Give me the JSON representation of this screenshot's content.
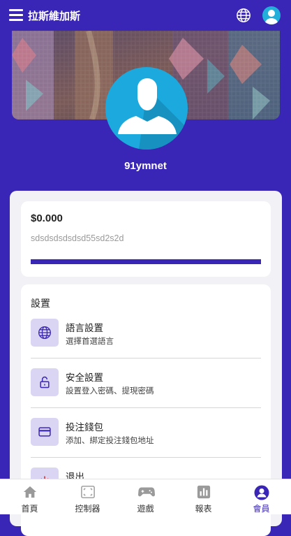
{
  "header": {
    "title": "拉斯維加斯"
  },
  "profile": {
    "username": "91ymnet"
  },
  "wallet": {
    "balance": "$0.000",
    "account_id": "sdsdsdsdsdsd55sd2s2d",
    "progress": 1.0
  },
  "settings": {
    "title": "設置",
    "items": [
      {
        "name": "語言設置",
        "desc": "選擇首選語言",
        "icon": "globe-icon"
      },
      {
        "name": "安全設置",
        "desc": "設置登入密碼、提現密碼",
        "icon": "lock-icon"
      },
      {
        "name": "投注錢包",
        "desc": "添加、綁定投注錢包地址",
        "icon": "card-icon"
      },
      {
        "name": "退出",
        "desc": "",
        "icon": "power-icon"
      }
    ]
  },
  "bottom_nav": {
    "items": [
      {
        "label": "首頁",
        "icon": "home-icon"
      },
      {
        "label": "控制器",
        "icon": "controller-icon"
      },
      {
        "label": "遊戲",
        "icon": "gamepad-icon"
      },
      {
        "label": "報表",
        "icon": "chart-icon"
      },
      {
        "label": "會員",
        "icon": "user-icon",
        "active": true
      }
    ]
  },
  "colors": {
    "primary": "#3a26b6",
    "avatar": "#1ba9de",
    "icon_bg": "#d9d5f3",
    "nav_icon": "#9a9a9a"
  }
}
